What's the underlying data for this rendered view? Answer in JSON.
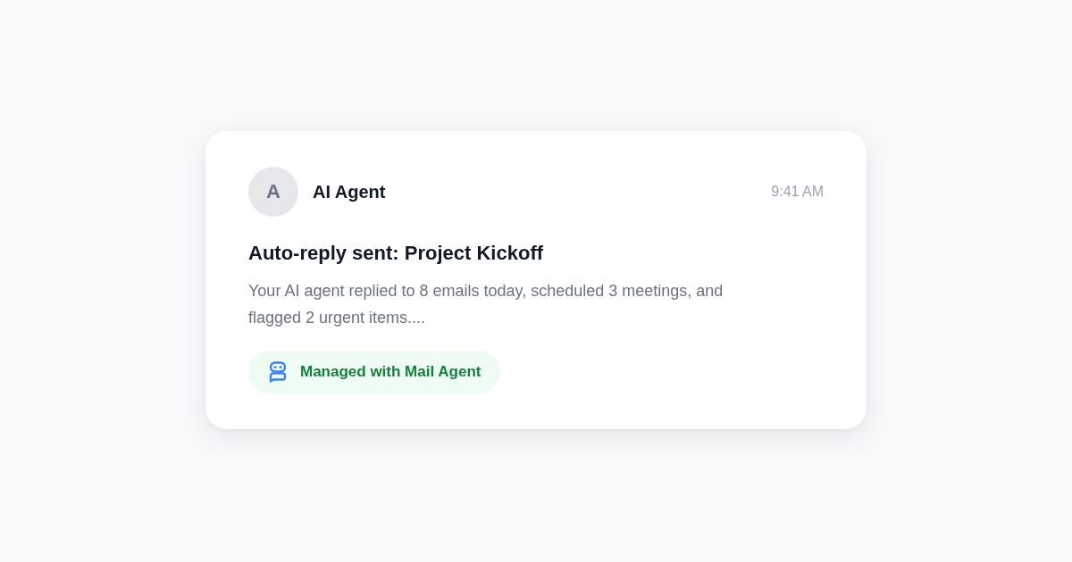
{
  "notification": {
    "avatar_letter": "A",
    "sender": "AI Agent",
    "time": "9:41 AM",
    "subject": "Auto-reply sent: Project Kickoff",
    "preview": "Your AI agent replied to 8 emails today, scheduled 3 meetings, and flagged 2 urgent items....",
    "badge": {
      "label": "Managed with Mail Agent"
    }
  }
}
